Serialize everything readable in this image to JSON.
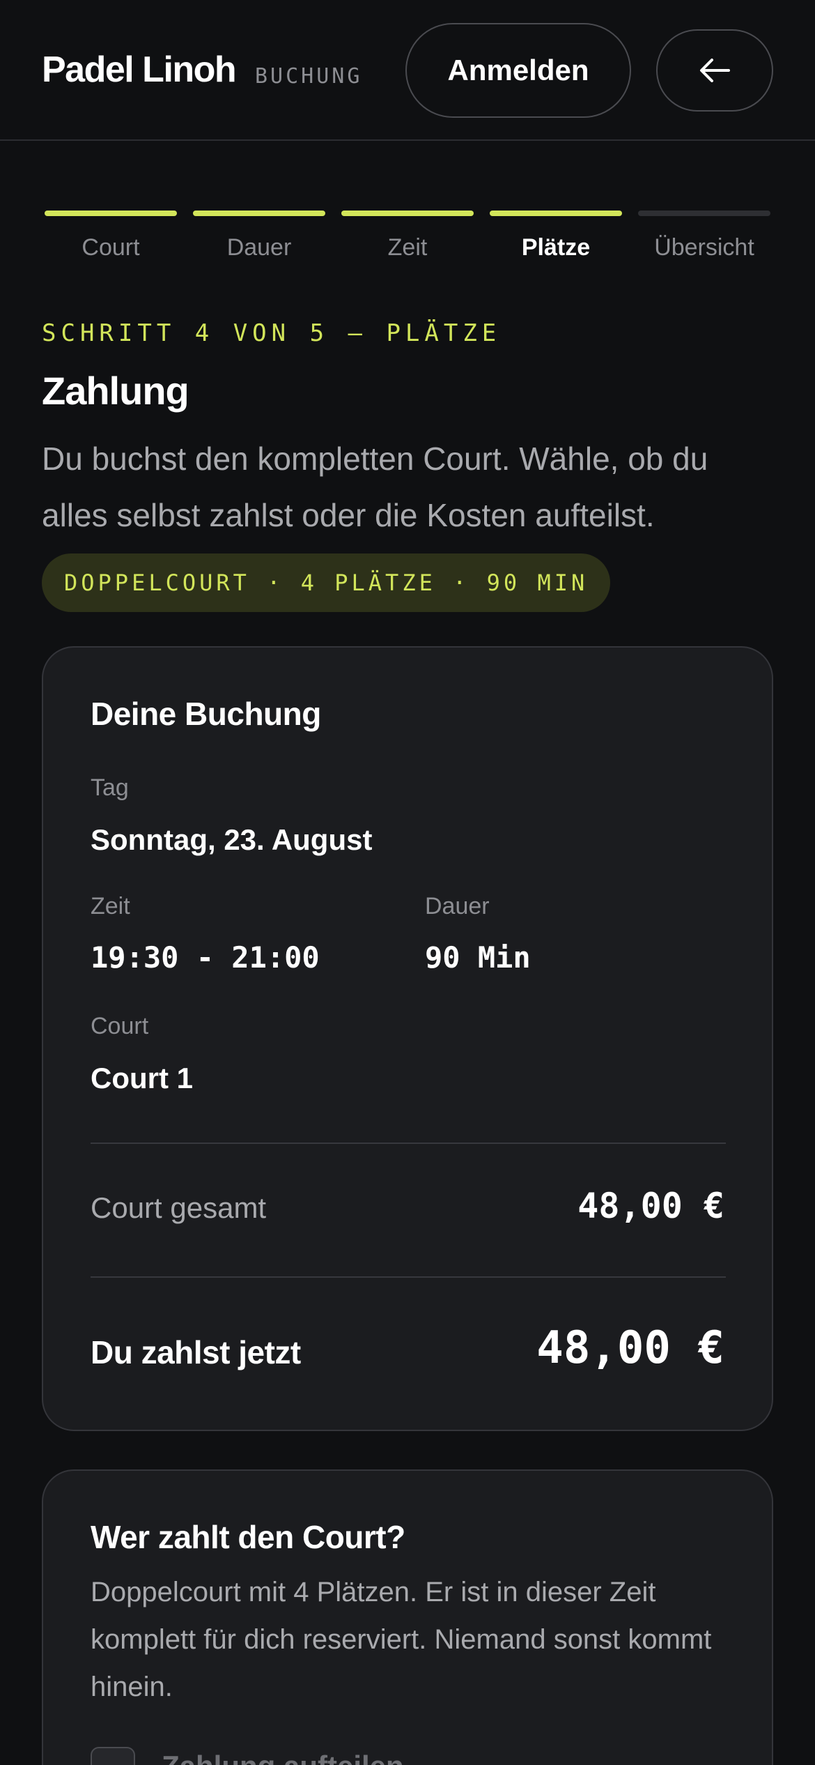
{
  "header": {
    "brand": "Padel Linoh",
    "brand_sub": "BUCHUNG",
    "login_label": "Anmelden",
    "back_icon": "arrow-left-icon"
  },
  "steps": [
    {
      "label": "Court",
      "state": "done"
    },
    {
      "label": "Dauer",
      "state": "done"
    },
    {
      "label": "Zeit",
      "state": "done"
    },
    {
      "label": "Plätze",
      "state": "active"
    },
    {
      "label": "Übersicht",
      "state": "todo"
    }
  ],
  "intro": {
    "kicker": "SCHRITT 4 VON 5 — PLÄTZE",
    "title": "Zahlung",
    "description": "Du buchst den kompletten Court. Wähle, ob du alles selbst zahlst oder die Kosten aufteilst.",
    "chip": "DOPPELCOURT · 4 PLÄTZE · 90 MIN"
  },
  "booking": {
    "title": "Deine Buchung",
    "day_label": "Tag",
    "day_value": "Sonntag, 23. August",
    "time_label": "Zeit",
    "time_value": "19:30 - 21:00",
    "duration_label": "Dauer",
    "duration_value": "90 Min",
    "court_label": "Court",
    "court_value": "Court 1",
    "subtotal_label": "Court gesamt",
    "subtotal_value": "48,00 €",
    "total_label": "Du zahlst jetzt",
    "total_value": "48,00 €"
  },
  "payer": {
    "title": "Wer zahlt den Court?",
    "text": "Doppelcourt mit 4 Plätzen. Er ist in dieser Zeit komplett für dich reserviert. Niemand sonst kommt hinein.",
    "split_label": "Zahlung aufteilen",
    "split_checked": false
  },
  "colors": {
    "accent": "#d2e55a",
    "background": "#0f1012",
    "card": "#1b1c1f",
    "muted_text": "#8d8e93"
  }
}
